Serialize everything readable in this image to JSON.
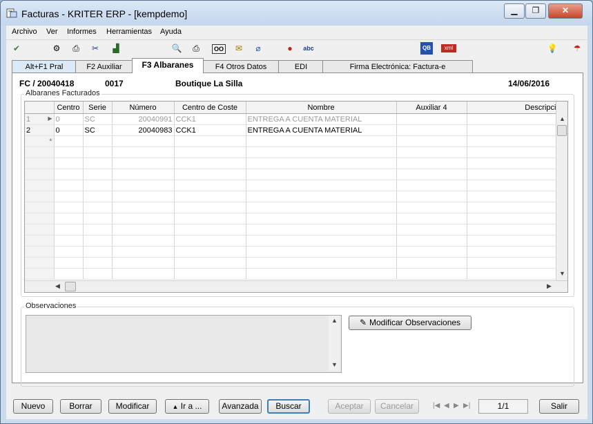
{
  "window": {
    "title": "Facturas - KRITER ERP - [kempdemo]"
  },
  "menu": [
    "Archivo",
    "Ver",
    "Informes",
    "Herramientas",
    "Ayuda"
  ],
  "toolbar": {
    "icons": [
      "check-icon",
      "tools-icon",
      "print-icon",
      "cut-icon",
      "chart-icon",
      "preview-icon",
      "printer-icon",
      "oo-icon",
      "mail-icon",
      "attach-icon",
      "red-dot-icon",
      "spellcheck-icon",
      "qb-icon",
      "xml-icon",
      "lightbulb-icon",
      "help-icon"
    ],
    "glyphs": {
      "oo": "OO",
      "abc": "abc",
      "qb": "QB",
      "xml": "xml"
    }
  },
  "tabs": [
    "Alt+F1 Pral",
    "F2 Auxiliar",
    "F3 Albaranes",
    "F4 Otros Datos",
    "EDI",
    "Firma Electrónica: Factura-e"
  ],
  "header": {
    "doc": "FC / 20040418",
    "code": "0017",
    "client": "Boutique La Silla",
    "date": "14/06/2016"
  },
  "albaranes": {
    "label": "Albaranes Facturados",
    "columns": [
      "Centro",
      "Serie",
      "Número",
      "Centro de Coste",
      "Nombre",
      "Auxiliar 4",
      "Descripci"
    ],
    "rows": [
      {
        "idx": "1",
        "centro": "0",
        "serie": "SC",
        "numero": "20040991",
        "coste": "CCK1",
        "nombre": "ENTREGA A CUENTA MATERIAL"
      },
      {
        "idx": "2",
        "centro": "0",
        "serie": "SC",
        "numero": "20040983",
        "coste": "CCK1",
        "nombre": "ENTREGA A CUENTA MATERIAL"
      }
    ],
    "new_row_marker": "*"
  },
  "observaciones": {
    "label": "Observaciones",
    "value": "",
    "button": "Modificar Observaciones"
  },
  "buttons": {
    "nuevo": "Nuevo",
    "borrar": "Borrar",
    "modificar": "Modificar",
    "ira": "Ir a ...",
    "avanzada": "Avanzada",
    "buscar": "Buscar",
    "aceptar": "Aceptar",
    "cancelar": "Cancelar",
    "salir": "Salir"
  },
  "pager": {
    "position": "1/1"
  }
}
